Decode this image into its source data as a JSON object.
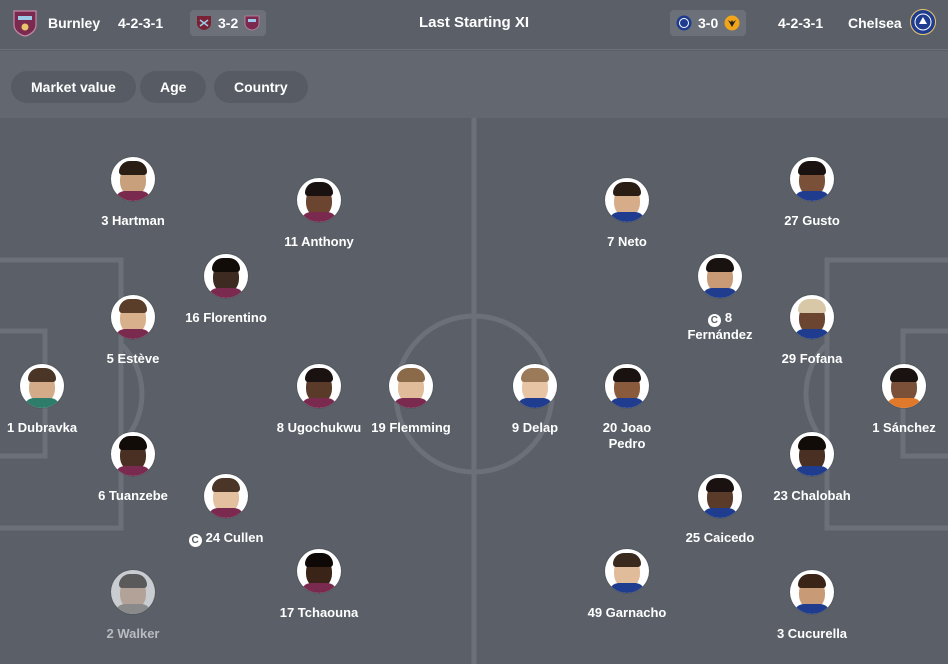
{
  "header": {
    "home_team": "Burnley",
    "home_formation": "4-2-3-1",
    "home_last_score": "3-2",
    "title": "Last Starting XI",
    "away_last_score": "3-0",
    "away_formation": "4-2-3-1",
    "away_team": "Chelsea"
  },
  "filters": [
    "Market value",
    "Age",
    "Country"
  ],
  "colors": {
    "burnley": "#7a2a4e",
    "burnley_light": "#9ccbe8",
    "chelsea": "#1f3c8f",
    "westham": "#7a2235",
    "wolves": "#f3a519",
    "pitch_lines": "#6b7079"
  },
  "captain_mark": "C",
  "home_players": [
    {
      "label": "3 Hartman"
    },
    {
      "label": "11 Anthony"
    },
    {
      "label": "16 Florentino"
    },
    {
      "label": "5 Estève"
    },
    {
      "label": "1 Dubravka"
    },
    {
      "label": "8 Ugochukwu"
    },
    {
      "label": "19 Flemming"
    },
    {
      "label": "6 Tuanzebe"
    },
    {
      "label": "24 Cullen"
    },
    {
      "label": "17 Tchaouna"
    },
    {
      "label": "2 Walker"
    }
  ],
  "away_players": [
    {
      "label": "7 Neto"
    },
    {
      "label": "27 Gusto"
    },
    {
      "label": "8"
    },
    {
      "label": "Fernández"
    },
    {
      "label": "29 Fofana"
    },
    {
      "label": "9 Delap"
    },
    {
      "label": "20 Joao"
    },
    {
      "label": "Pedro"
    },
    {
      "label": "1 Sánchez"
    },
    {
      "label": "23 Chalobah"
    },
    {
      "label": "25 Caicedo"
    },
    {
      "label": "49 Garnacho"
    },
    {
      "label": "3 Cucurella"
    }
  ]
}
